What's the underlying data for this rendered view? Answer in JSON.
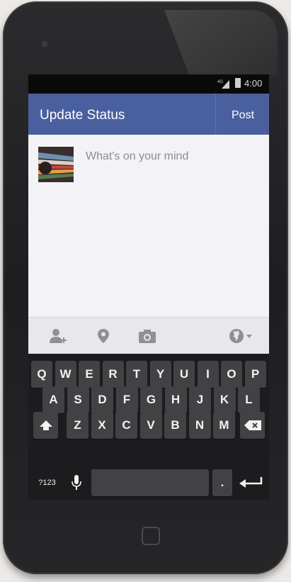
{
  "status_bar": {
    "network": "4G",
    "time": "4:00"
  },
  "action_bar": {
    "title": "Update Status",
    "post_label": "Post"
  },
  "composer": {
    "placeholder": "What's on your mind"
  },
  "toolbar": {
    "icons": [
      "tag-friends-icon",
      "location-icon",
      "camera-icon",
      "audience-globe-icon"
    ]
  },
  "keyboard": {
    "row1": [
      "Q",
      "W",
      "E",
      "R",
      "T",
      "Y",
      "U",
      "I",
      "O",
      "P"
    ],
    "row2": [
      "A",
      "S",
      "D",
      "F",
      "G",
      "H",
      "J",
      "K",
      "L"
    ],
    "row3": [
      "Z",
      "X",
      "C",
      "V",
      "B",
      "N",
      "M"
    ],
    "symbols_label": "?123",
    "period": "."
  },
  "colors": {
    "header": "#4a5f9e",
    "keyboard": "#1c1c1e",
    "key": "#424245"
  }
}
